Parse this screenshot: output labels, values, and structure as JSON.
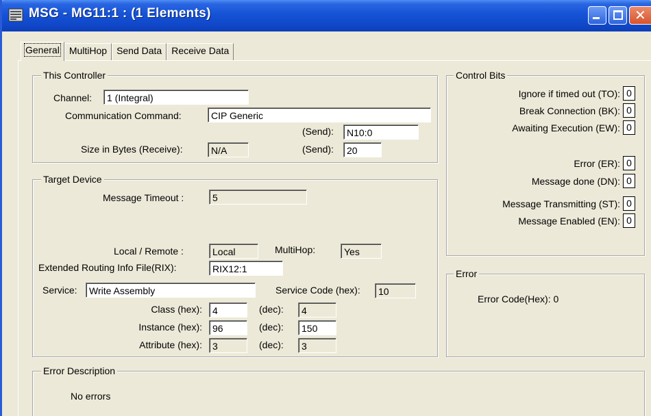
{
  "window": {
    "title": "MSG - MG11:1 : (1 Elements)"
  },
  "tabs": [
    "General",
    "MultiHop",
    "Send Data",
    "Receive Data"
  ],
  "this_controller": {
    "label": "This Controller",
    "channel_label": "Channel:",
    "channel_value": "1 (Integral)",
    "command_label": "Communication Command:",
    "command_value": "CIP Generic",
    "send1_label": "(Send):",
    "send1_value": "N10:0",
    "size_label": "Size in Bytes (Receive):",
    "size_receive_value": "N/A",
    "send2_label": "(Send):",
    "send2_value": "20"
  },
  "target_device": {
    "label": "Target Device",
    "timeout_label": "Message Timeout :",
    "timeout_value": "5",
    "local_remote_label": "Local / Remote :",
    "local_remote_value": "Local",
    "multihop_label": "MultiHop:",
    "multihop_value": "Yes",
    "rix_label": "Extended Routing Info File(RIX):",
    "rix_value": "RIX12:1",
    "service_label": "Service:",
    "service_value": "Write Assembly",
    "service_code_label": "Service Code (hex):",
    "service_code_value": "10",
    "class_label": "Class (hex):",
    "class_hex": "4",
    "class_dec_label": "(dec):",
    "class_dec": "4",
    "instance_label": "Instance (hex):",
    "instance_hex": "96",
    "instance_dec_label": "(dec):",
    "instance_dec": "150",
    "attribute_label": "Attribute (hex):",
    "attribute_hex": "3",
    "attribute_dec_label": "(dec):",
    "attribute_dec": "3"
  },
  "control_bits": {
    "label": "Control Bits",
    "items": [
      {
        "label": "Ignore if timed out (TO):",
        "value": "0"
      },
      {
        "label": "Break Connection (BK):",
        "value": "0"
      },
      {
        "label": "Awaiting Execution (EW):",
        "value": "0"
      },
      {
        "label": "Error (ER):",
        "value": "0"
      },
      {
        "label": "Message done (DN):",
        "value": "0"
      },
      {
        "label": "Message Transmitting (ST):",
        "value": "0"
      },
      {
        "label": "Message Enabled (EN):",
        "value": "0"
      }
    ]
  },
  "error": {
    "label": "Error",
    "code_text": "Error Code(Hex): 0"
  },
  "error_description": {
    "label": "Error Description",
    "text": "No errors"
  },
  "icons": {
    "app": "app-icon",
    "minimize": "minimize-icon",
    "maximize": "maximize-icon",
    "close": "close-icon"
  },
  "colors": {
    "title_bar": "#1553d6",
    "dialog_bg": "#ece9d8",
    "close_button": "#d7542d"
  }
}
